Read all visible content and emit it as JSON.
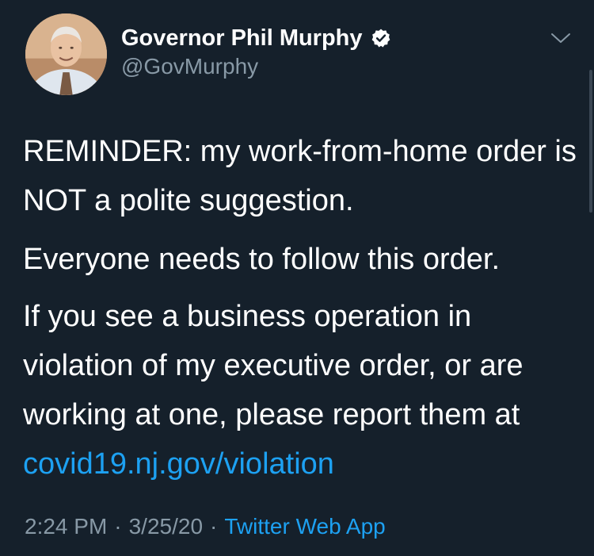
{
  "tweet": {
    "author": {
      "display_name": "Governor Phil Murphy",
      "handle": "@GovMurphy",
      "verified": true
    },
    "body": {
      "paragraph_1": "REMINDER: my work-from-home order is NOT a polite suggestion.",
      "paragraph_2": "Everyone needs to follow this order.",
      "paragraph_3_text": "If you see a business operation in violation of my executive order, or are working at one, please report them at",
      "link_text": "covid19.nj.gov/violation"
    },
    "meta": {
      "time": "2:24 PM",
      "separator": "·",
      "date": "3/25/20",
      "source": "Twitter Web App"
    }
  },
  "colors": {
    "background": "#15202b",
    "text_primary": "#ffffff",
    "text_secondary": "#8899a6",
    "link": "#1da1f2"
  },
  "icons": {
    "verified": "verified-badge-icon",
    "menu": "chevron-down-icon"
  }
}
